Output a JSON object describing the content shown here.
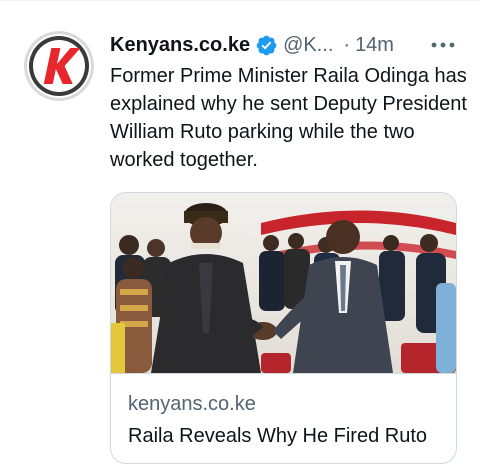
{
  "tweet": {
    "author": {
      "display_name": "Kenyans.co.ke",
      "handle": "@K...",
      "verified": true,
      "avatar_letter": "K"
    },
    "separator": "·",
    "timestamp": "14m",
    "text": "Former Prime Minister Raila Odinga has explained why he sent Deputy President William Ruto parking while the two worked together.",
    "link_card": {
      "domain": "kenyans.co.ke",
      "title": "Raila Reveals Why He Fired Ruto"
    }
  },
  "colors": {
    "verified_badge": "#1d9bf0",
    "secondary_text": "#536471",
    "primary_text": "#0f1419",
    "card_border": "#cfd9de",
    "avatar_brand": "#e8272c"
  },
  "icons": {
    "verified": "verified-badge-icon",
    "more": "more-options-icon"
  }
}
